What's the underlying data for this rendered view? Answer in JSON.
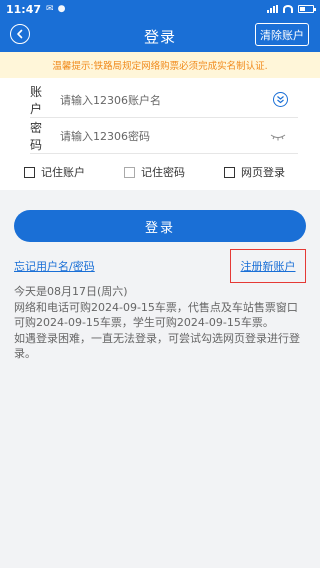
{
  "status_bar": {
    "time": "11:47",
    "icons": [
      "mail-icon",
      "chat-icon",
      "signal-icon",
      "wifi-icon",
      "battery-icon"
    ],
    "battery_level": 0.45
  },
  "header": {
    "title": "登录",
    "clear_account": "清除账户",
    "back_icon": "back-arrow-icon"
  },
  "tip": "温馨提示:铁路局规定网络购票必须完成实名制认证.",
  "form": {
    "account_label": "账 户",
    "account_placeholder": "请输入12306账户名",
    "password_label": "密 码",
    "password_placeholder": "请输入12306密码"
  },
  "options": {
    "remember_account": "记住账户",
    "remember_password": "记住密码",
    "web_login": "网页登录"
  },
  "login_button": "登录",
  "forgot_link": "忘记用户名/密码",
  "register_link": "注册新账户",
  "info": {
    "line1": "今天是08月17日(周六)",
    "line2": "网络和电话可购2024-09-15车票，代售点及车站售票窗口可购2024-09-15车票，学生可购2024-09-15车票。",
    "line3": "如遇登录困难，一直无法登录，可尝试勾选网页登录进行登录。"
  },
  "colors": {
    "primary": "#1a6fd6",
    "tip_bg": "#fff6d9",
    "tip_text": "#f08a1c",
    "highlight": "#e53935"
  }
}
